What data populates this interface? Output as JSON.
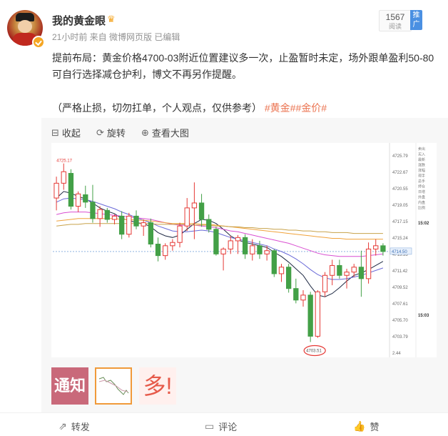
{
  "post": {
    "username": "我的黄金眼",
    "meta": "21小时前  来自 微博网页版 已编辑",
    "read_count": "1567",
    "read_label": "阅读",
    "promote_label": "推广",
    "body_line1": "提前布局：黄金价格4700-03附近位置建议多一次，止盈暂时未定，场外跟单盈利50-80可自行选择减仓护利，博文不再另作提醒。",
    "body_line2": "（严格止损，切勿扛单，个人观点，仅供参考）",
    "tags": "#黄金##金价#"
  },
  "media_toolbar": {
    "collapse_label": "收起",
    "rotate_label": "旋转",
    "view_large_label": "查看大图"
  },
  "chart_data": {
    "type": "candlestick",
    "price_axis_ticks": [
      "4725.79",
      "4722.67",
      "4720.55",
      "4719.05",
      "4717.15",
      "4715.24",
      "4713.33",
      "4711.42",
      "4709.52",
      "4707.61",
      "4705.70",
      "4703.79",
      "2.44"
    ],
    "high_marker_label": "4725.17",
    "low_marker_label": "4703.51",
    "current_price_label": "4714.50",
    "side_panel_labels": [
      "卖出",
      "买入",
      "最新",
      "涨跌",
      "涨幅",
      "现手",
      "总手",
      "持仓",
      "日增",
      "外盘",
      "内盘",
      "比例"
    ],
    "side_panel_times": [
      "15:02",
      "15:03"
    ],
    "candles": [
      {
        "o": 4721.0,
        "h": 4723.6,
        "l": 4719.5,
        "c": 4722.8
      },
      {
        "o": 4722.8,
        "h": 4725.2,
        "l": 4722.0,
        "c": 4724.2
      },
      {
        "o": 4724.0,
        "h": 4724.5,
        "l": 4719.6,
        "c": 4720.0
      },
      {
        "o": 4720.0,
        "h": 4721.8,
        "l": 4719.3,
        "c": 4721.5
      },
      {
        "o": 4721.4,
        "h": 4722.5,
        "l": 4719.8,
        "c": 4720.5
      },
      {
        "o": 4720.5,
        "h": 4722.6,
        "l": 4718.0,
        "c": 4718.5
      },
      {
        "o": 4718.5,
        "h": 4720.0,
        "l": 4717.5,
        "c": 4719.6
      },
      {
        "o": 4719.5,
        "h": 4719.8,
        "l": 4718.0,
        "c": 4718.4
      },
      {
        "o": 4718.4,
        "h": 4719.0,
        "l": 4717.8,
        "c": 4718.8
      },
      {
        "o": 4718.8,
        "h": 4719.4,
        "l": 4716.0,
        "c": 4716.6
      },
      {
        "o": 4716.6,
        "h": 4719.2,
        "l": 4716.2,
        "c": 4718.8
      },
      {
        "o": 4718.8,
        "h": 4719.5,
        "l": 4717.2,
        "c": 4717.6
      },
      {
        "o": 4717.6,
        "h": 4718.4,
        "l": 4716.4,
        "c": 4718.0
      },
      {
        "o": 4718.0,
        "h": 4718.5,
        "l": 4715.0,
        "c": 4715.4
      },
      {
        "o": 4715.4,
        "h": 4716.2,
        "l": 4713.3,
        "c": 4714.0
      },
      {
        "o": 4714.0,
        "h": 4715.5,
        "l": 4713.5,
        "c": 4715.2
      },
      {
        "o": 4715.2,
        "h": 4716.0,
        "l": 4714.6,
        "c": 4715.6
      },
      {
        "o": 4715.6,
        "h": 4718.0,
        "l": 4715.0,
        "c": 4717.6
      },
      {
        "o": 4717.6,
        "h": 4721.0,
        "l": 4717.0,
        "c": 4719.8
      },
      {
        "o": 4719.8,
        "h": 4722.9,
        "l": 4716.0,
        "c": 4720.4
      },
      {
        "o": 4720.4,
        "h": 4721.5,
        "l": 4717.5,
        "c": 4718.4
      },
      {
        "o": 4718.4,
        "h": 4719.0,
        "l": 4716.8,
        "c": 4717.2
      },
      {
        "o": 4717.2,
        "h": 4717.5,
        "l": 4714.0,
        "c": 4714.2
      },
      {
        "o": 4714.2,
        "h": 4715.0,
        "l": 4712.2,
        "c": 4714.8
      },
      {
        "o": 4714.8,
        "h": 4716.4,
        "l": 4714.2,
        "c": 4715.8
      },
      {
        "o": 4715.8,
        "h": 4716.5,
        "l": 4714.2,
        "c": 4716.2
      },
      {
        "o": 4716.2,
        "h": 4716.6,
        "l": 4713.6,
        "c": 4714.2
      },
      {
        "o": 4714.2,
        "h": 4716.0,
        "l": 4713.4,
        "c": 4715.2
      },
      {
        "o": 4715.2,
        "h": 4715.8,
        "l": 4713.6,
        "c": 4714.2
      },
      {
        "o": 4714.2,
        "h": 4715.2,
        "l": 4713.4,
        "c": 4714.6
      },
      {
        "o": 4714.6,
        "h": 4714.8,
        "l": 4711.4,
        "c": 4711.8
      },
      {
        "o": 4711.8,
        "h": 4713.0,
        "l": 4710.8,
        "c": 4712.6
      },
      {
        "o": 4712.6,
        "h": 4713.0,
        "l": 4709.5,
        "c": 4710.0
      },
      {
        "o": 4710.0,
        "h": 4711.2,
        "l": 4708.2,
        "c": 4708.6
      },
      {
        "o": 4708.6,
        "h": 4709.8,
        "l": 4707.8,
        "c": 4709.2
      },
      {
        "o": 4709.2,
        "h": 4709.6,
        "l": 4703.5,
        "c": 4704.2
      },
      {
        "o": 4704.2,
        "h": 4709.8,
        "l": 4704.0,
        "c": 4709.6
      },
      {
        "o": 4709.6,
        "h": 4712.0,
        "l": 4709.0,
        "c": 4711.6
      },
      {
        "o": 4711.6,
        "h": 4713.5,
        "l": 4710.4,
        "c": 4712.8
      },
      {
        "o": 4712.8,
        "h": 4713.5,
        "l": 4711.2,
        "c": 4711.6
      },
      {
        "o": 4711.6,
        "h": 4712.4,
        "l": 4710.0,
        "c": 4712.0
      },
      {
        "o": 4712.0,
        "h": 4713.0,
        "l": 4711.4,
        "c": 4712.6
      },
      {
        "o": 4712.6,
        "h": 4714.6,
        "l": 4709.0,
        "c": 4711.2
      },
      {
        "o": 4711.2,
        "h": 4715.6,
        "l": 4710.6,
        "c": 4714.8
      },
      {
        "o": 4714.8,
        "h": 4716.0,
        "l": 4714.0,
        "c": 4715.2
      },
      {
        "o": 4715.2,
        "h": 4715.5,
        "l": 4714.0,
        "c": 4714.5
      }
    ],
    "ma_lines": [
      {
        "color": "#1f2a44",
        "values": [
          4721,
          4721.8,
          4721.6,
          4721.2,
          4720.9,
          4720.4,
          4719.8,
          4719.4,
          4719.1,
          4718.5,
          4718.3,
          4718.0,
          4717.9,
          4717.5,
          4716.8,
          4716.4,
          4716.2,
          4716.5,
          4717.2,
          4717.9,
          4718.4,
          4718.3,
          4717.9,
          4717.2,
          4716.4,
          4715.9,
          4715.6,
          4715.4,
          4715.2,
          4715.0,
          4714.4,
          4713.9,
          4713.2,
          4712.4,
          4711.6,
          4710.3,
          4709.2,
          4709.0,
          4709.4,
          4710.1,
          4710.9,
          4711.6,
          4711.9,
          4712.3,
          4712.8,
          4713.3
        ]
      },
      {
        "color": "#6a6ad8",
        "values": [
          4720.5,
          4720.9,
          4721.0,
          4720.9,
          4720.8,
          4720.6,
          4720.3,
          4720.0,
          4719.7,
          4719.3,
          4719.0,
          4718.6,
          4718.3,
          4718.0,
          4717.6,
          4717.3,
          4717.0,
          4716.9,
          4716.9,
          4717.0,
          4717.1,
          4717.0,
          4716.8,
          4716.5,
          4716.2,
          4716.0,
          4715.8,
          4715.6,
          4715.4,
          4715.2,
          4714.8,
          4714.5,
          4714.1,
          4713.6,
          4713.0,
          4712.3,
          4711.7,
          4711.3,
          4711.1,
          4711.1,
          4711.2,
          4711.4,
          4711.6,
          4711.9,
          4712.2,
          4712.5
        ]
      },
      {
        "color": "#d94fd1",
        "values": [
          4719.0,
          4719.2,
          4719.3,
          4719.3,
          4719.3,
          4719.2,
          4719.1,
          4719.0,
          4718.9,
          4718.8,
          4718.7,
          4718.6,
          4718.5,
          4718.4,
          4718.2,
          4718.0,
          4717.8,
          4717.7,
          4717.7,
          4717.7,
          4717.6,
          4717.5,
          4717.4,
          4717.2,
          4717.0,
          4716.9,
          4716.7,
          4716.5,
          4716.3,
          4716.1,
          4715.9,
          4715.7,
          4715.5,
          4715.2,
          4714.9,
          4714.6,
          4714.3,
          4714.1,
          4714.0,
          4713.9,
          4713.9,
          4713.9,
          4713.9,
          4714.0,
          4714.1,
          4714.2
        ]
      },
      {
        "color": "#f0a23a",
        "values": [
          4718.2,
          4718.3,
          4718.4,
          4718.5,
          4718.5,
          4718.5,
          4718.5,
          4718.5,
          4718.5,
          4718.4,
          4718.4,
          4718.3,
          4718.3,
          4718.2,
          4718.1,
          4718.0,
          4717.9,
          4717.9,
          4717.9,
          4717.9,
          4717.8,
          4717.8,
          4717.7,
          4717.6,
          4717.5,
          4717.4,
          4717.3,
          4717.2,
          4717.1,
          4717.0,
          4716.9,
          4716.8,
          4716.7,
          4716.6,
          4716.5,
          4716.4,
          4716.3,
          4716.2,
          4716.1,
          4716.1,
          4716.0,
          4716.0,
          4716.0,
          4716.0,
          4716.0,
          4716.0
        ]
      },
      {
        "color": "#c8a24a",
        "values": [
          4717.6,
          4717.7,
          4717.8,
          4717.8,
          4717.9,
          4717.9,
          4717.9,
          4717.9,
          4717.9,
          4717.9,
          4717.9,
          4717.9,
          4717.9,
          4717.9,
          4717.8,
          4717.8,
          4717.8,
          4717.8,
          4717.8,
          4717.7,
          4717.7,
          4717.7,
          4717.6,
          4717.6,
          4717.5,
          4717.5,
          4717.4,
          4717.4,
          4717.3,
          4717.3,
          4717.2,
          4717.2,
          4717.1,
          4717.1,
          4717.0,
          4717.0,
          4716.9,
          4716.9,
          4716.8,
          4716.8,
          4716.8,
          4716.7,
          4716.7,
          4716.7,
          4716.7,
          4716.7
        ]
      }
    ],
    "ylim": [
      4702.5,
      4727.0
    ],
    "up_color": "#e53935",
    "down_color": "#43a047"
  },
  "thumbnails": {
    "notice_label": "通知",
    "buy_label": "多!"
  },
  "footer": {
    "forward_label": "转发",
    "comment_label": "评论",
    "like_label": "赞"
  },
  "colors": {
    "tag_color": "#eb7350",
    "promote_bg": "#4a90e2"
  }
}
